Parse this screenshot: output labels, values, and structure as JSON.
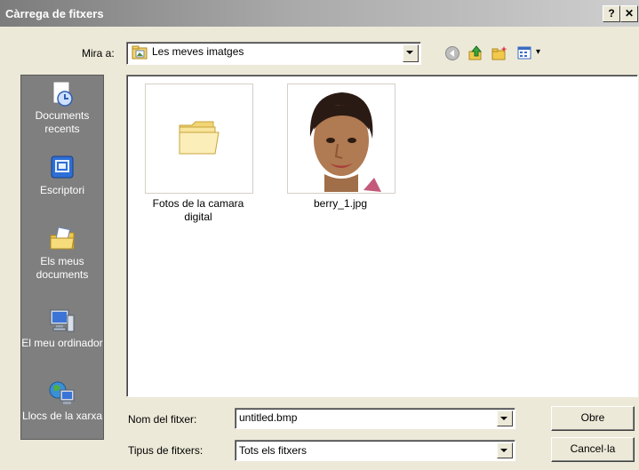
{
  "window": {
    "title": "Càrrega de fitxers",
    "help_label": "?",
    "close_label": "✕"
  },
  "lookin": {
    "label": "Mira a:",
    "value": "Les meves imatges"
  },
  "toolbar": {
    "icons": [
      "back-icon",
      "up-folder-icon",
      "new-folder-icon",
      "views-menu-icon"
    ],
    "views_arrow": "▾"
  },
  "places": [
    {
      "label": "Documents recents",
      "icon": "recent-documents-icon"
    },
    {
      "label": "Escriptori",
      "icon": "desktop-icon"
    },
    {
      "label": "Els meus documents",
      "icon": "my-documents-icon"
    },
    {
      "label": "El meu ordinador",
      "icon": "my-computer-icon"
    },
    {
      "label": "Llocs de la xarxa",
      "icon": "network-places-icon"
    }
  ],
  "files": [
    {
      "name": "Fotos de la camara digital",
      "type": "folder"
    },
    {
      "name": "berry_1.jpg",
      "type": "image"
    }
  ],
  "filename": {
    "label": "Nom del fitxer:",
    "value": "untitled.bmp"
  },
  "filetype": {
    "label": "Tipus de fitxers:",
    "value": "Tots els fitxers"
  },
  "buttons": {
    "open": "Obre",
    "cancel": "Cancel·la"
  }
}
